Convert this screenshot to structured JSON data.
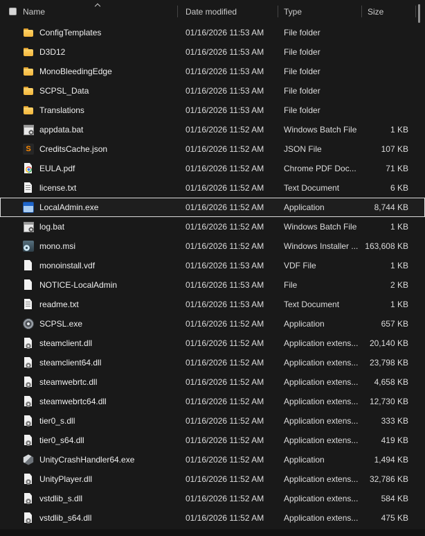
{
  "window": {
    "view": "file-explorer-details-list",
    "background": "#191919"
  },
  "colors": {
    "background": "#191919",
    "row_text": "#dcdcdc",
    "header_text": "#cccccc",
    "divider": "#454545",
    "selection_outline": "#dcdcdc",
    "folder_icon": "#f2b63c",
    "scrollbar_thumb": "#8f8f8f"
  },
  "header": {
    "select_all_checkbox": {
      "checked": false
    },
    "sort": {
      "column": "Name",
      "direction": "ascending"
    },
    "columns": [
      {
        "label": "Name"
      },
      {
        "label": "Date modified"
      },
      {
        "label": "Type"
      },
      {
        "label": "Size"
      }
    ]
  },
  "rows": [
    {
      "name": "ConfigTemplates",
      "date": "01/16/2026 11:53 AM",
      "type": "File folder",
      "size": "",
      "icon": "folder",
      "selected": false
    },
    {
      "name": "D3D12",
      "date": "01/16/2026 11:53 AM",
      "type": "File folder",
      "size": "",
      "icon": "folder",
      "selected": false
    },
    {
      "name": "MonoBleedingEdge",
      "date": "01/16/2026 11:53 AM",
      "type": "File folder",
      "size": "",
      "icon": "folder",
      "selected": false
    },
    {
      "name": "SCPSL_Data",
      "date": "01/16/2026 11:53 AM",
      "type": "File folder",
      "size": "",
      "icon": "folder",
      "selected": false
    },
    {
      "name": "Translations",
      "date": "01/16/2026 11:53 AM",
      "type": "File folder",
      "size": "",
      "icon": "folder",
      "selected": false
    },
    {
      "name": "appdata.bat",
      "date": "01/16/2026 11:52 AM",
      "type": "Windows Batch File",
      "size": "1 KB",
      "icon": "batch",
      "selected": false
    },
    {
      "name": "CreditsCache.json",
      "date": "01/16/2026 11:52 AM",
      "type": "JSON File",
      "size": "107 KB",
      "icon": "json",
      "selected": false
    },
    {
      "name": "EULA.pdf",
      "date": "01/16/2026 11:52 AM",
      "type": "Chrome PDF Doc...",
      "size": "71 KB",
      "icon": "chrome-pdf",
      "selected": false
    },
    {
      "name": "license.txt",
      "date": "01/16/2026 11:52 AM",
      "type": "Text Document",
      "size": "6 KB",
      "icon": "text",
      "selected": false
    },
    {
      "name": "LocalAdmin.exe",
      "date": "01/16/2026 11:52 AM",
      "type": "Application",
      "size": "8,744 KB",
      "icon": "app-window",
      "selected": true
    },
    {
      "name": "log.bat",
      "date": "01/16/2026 11:52 AM",
      "type": "Windows Batch File",
      "size": "1 KB",
      "icon": "batch",
      "selected": false
    },
    {
      "name": "mono.msi",
      "date": "01/16/2026 11:52 AM",
      "type": "Windows Installer ...",
      "size": "163,608 KB",
      "icon": "installer",
      "selected": false
    },
    {
      "name": "monoinstall.vdf",
      "date": "01/16/2026 11:53 AM",
      "type": "VDF File",
      "size": "1 KB",
      "icon": "file",
      "selected": false
    },
    {
      "name": "NOTICE-LocalAdmin",
      "date": "01/16/2026 11:53 AM",
      "type": "File",
      "size": "2 KB",
      "icon": "file",
      "selected": false
    },
    {
      "name": "readme.txt",
      "date": "01/16/2026 11:53 AM",
      "type": "Text Document",
      "size": "1 KB",
      "icon": "text",
      "selected": false
    },
    {
      "name": "SCPSL.exe",
      "date": "01/16/2026 11:52 AM",
      "type": "Application",
      "size": "657 KB",
      "icon": "scp",
      "selected": false
    },
    {
      "name": "steamclient.dll",
      "date": "01/16/2026 11:52 AM",
      "type": "Application extens...",
      "size": "20,140 KB",
      "icon": "dll",
      "selected": false
    },
    {
      "name": "steamclient64.dll",
      "date": "01/16/2026 11:52 AM",
      "type": "Application extens...",
      "size": "23,798 KB",
      "icon": "dll",
      "selected": false
    },
    {
      "name": "steamwebrtc.dll",
      "date": "01/16/2026 11:52 AM",
      "type": "Application extens...",
      "size": "4,658 KB",
      "icon": "dll",
      "selected": false
    },
    {
      "name": "steamwebrtc64.dll",
      "date": "01/16/2026 11:52 AM",
      "type": "Application extens...",
      "size": "12,730 KB",
      "icon": "dll",
      "selected": false
    },
    {
      "name": "tier0_s.dll",
      "date": "01/16/2026 11:52 AM",
      "type": "Application extens...",
      "size": "333 KB",
      "icon": "dll",
      "selected": false
    },
    {
      "name": "tier0_s64.dll",
      "date": "01/16/2026 11:52 AM",
      "type": "Application extens...",
      "size": "419 KB",
      "icon": "dll",
      "selected": false
    },
    {
      "name": "UnityCrashHandler64.exe",
      "date": "01/16/2026 11:52 AM",
      "type": "Application",
      "size": "1,494 KB",
      "icon": "unity",
      "selected": false
    },
    {
      "name": "UnityPlayer.dll",
      "date": "01/16/2026 11:52 AM",
      "type": "Application extens...",
      "size": "32,786 KB",
      "icon": "dll",
      "selected": false
    },
    {
      "name": "vstdlib_s.dll",
      "date": "01/16/2026 11:52 AM",
      "type": "Application extens...",
      "size": "584 KB",
      "icon": "dll",
      "selected": false
    },
    {
      "name": "vstdlib_s64.dll",
      "date": "01/16/2026 11:52 AM",
      "type": "Application extens...",
      "size": "475 KB",
      "icon": "dll",
      "selected": false
    }
  ]
}
